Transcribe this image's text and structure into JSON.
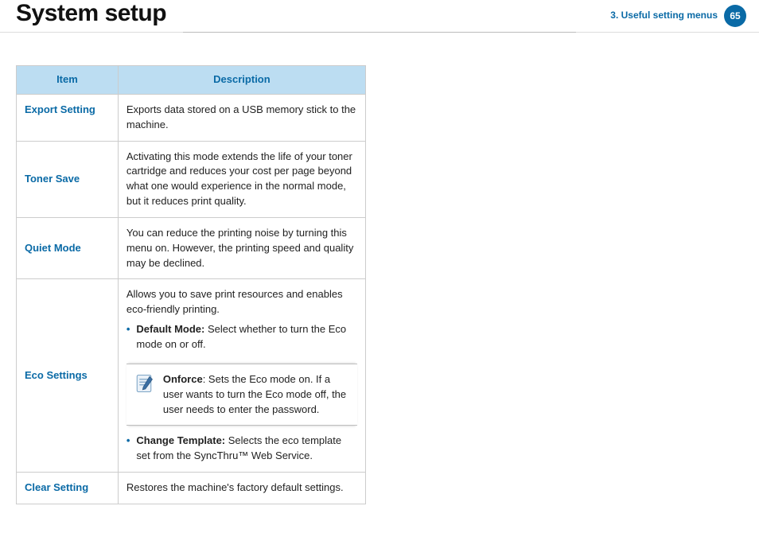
{
  "header": {
    "title": "System setup",
    "chapter": "3.  Useful setting menus",
    "page": "65"
  },
  "table": {
    "head_item": "Item",
    "head_desc": "Description",
    "rows": {
      "export": {
        "item": "Export Setting",
        "desc": "Exports data stored on a USB memory stick to the machine."
      },
      "toner": {
        "item": "Toner Save",
        "desc": "Activating this mode extends the life of your toner cartridge and reduces your cost per page beyond what one would experience in the normal mode, but it reduces print quality."
      },
      "quiet": {
        "item": "Quiet Mode",
        "desc": "You can reduce the printing noise by turning this menu on. However, the printing speed and quality may be declined."
      },
      "eco": {
        "item": "Eco Settings",
        "intro": "Allows you to save print resources and enables eco-friendly printing.",
        "default_label": "Default Mode:",
        "default_rest": " Select whether to turn the Eco mode on or off.",
        "note_label": "Onforce",
        "note_rest": ": Sets the Eco mode on. If a user wants to turn the Eco mode off, the user needs to enter the password.",
        "change_label": "Change Template:",
        "change_rest": " Selects the eco template set from the SyncThru™ Web Service."
      },
      "clear": {
        "item": "Clear Setting",
        "desc": "Restores the machine's factory default settings."
      }
    }
  }
}
